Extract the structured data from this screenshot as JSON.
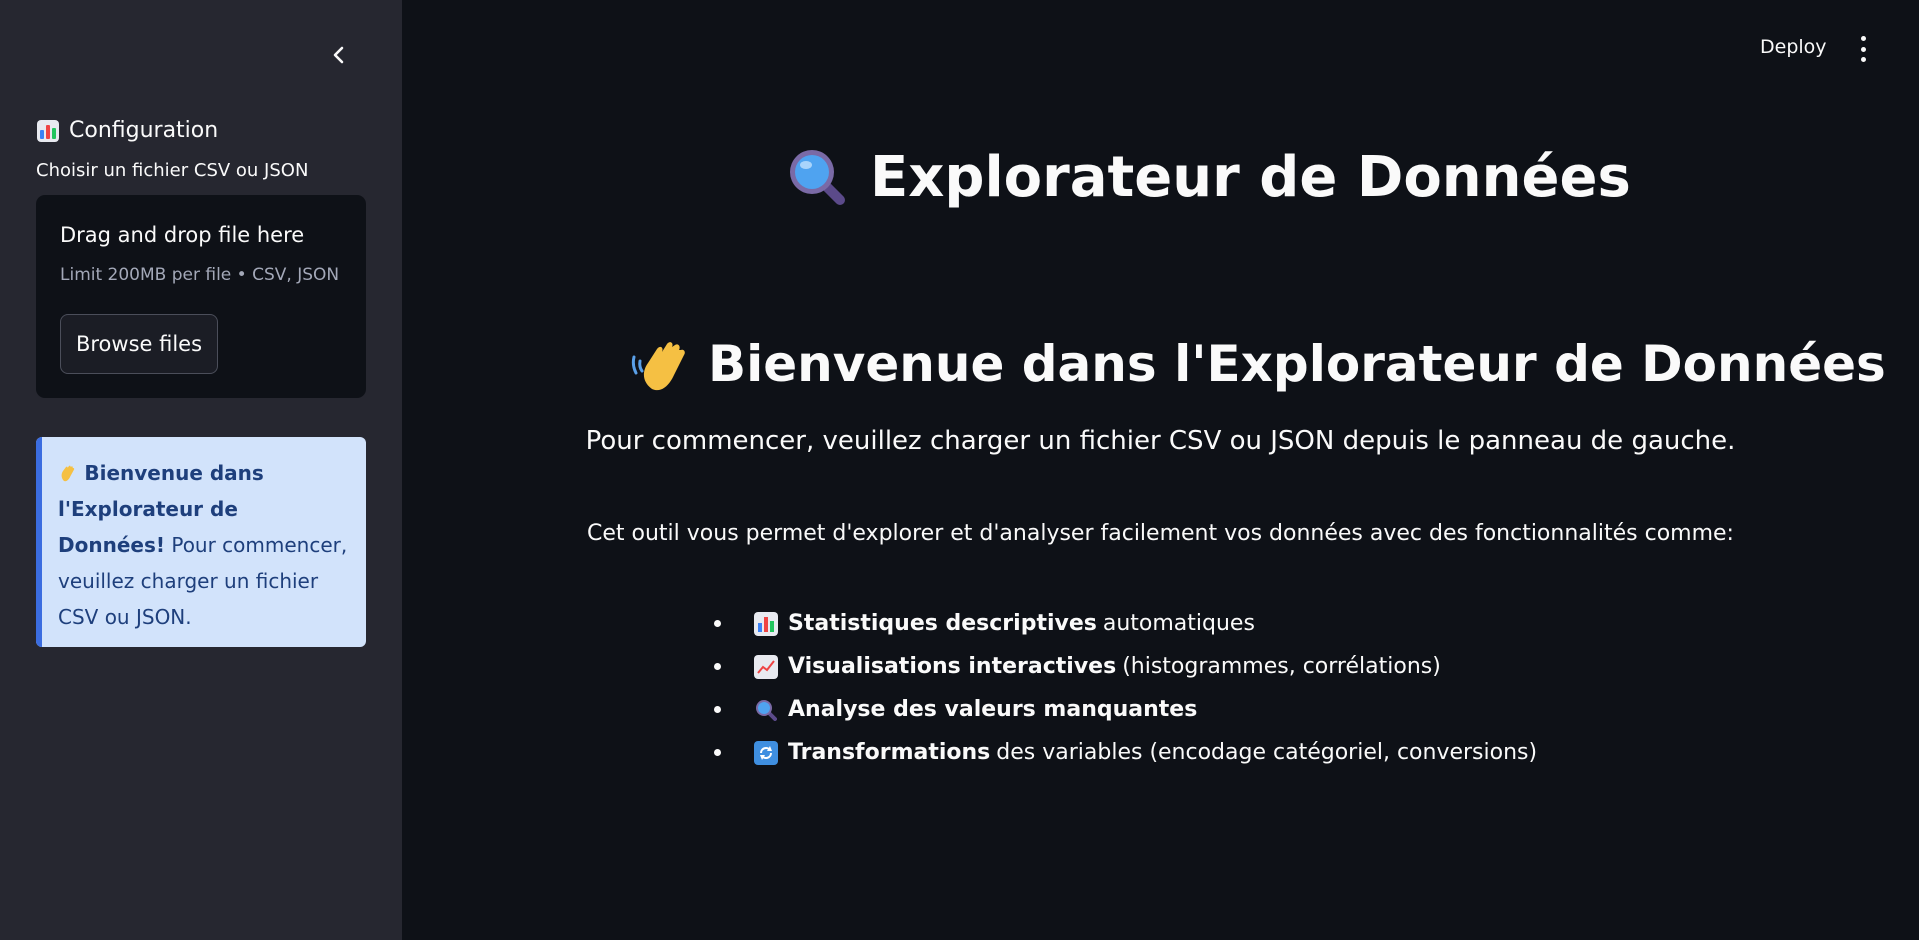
{
  "sidebar": {
    "title": "Configuration",
    "uploader_label": "Choisir un fichier CSV ou JSON",
    "dropzone_text": "Drag and drop file here",
    "limit_text": "Limit 200MB per file • CSV, JSON",
    "browse_label": "Browse files",
    "info": {
      "bold_text": "Bienvenue dans l'Explorateur de Données!",
      "body_text": "Pour commencer, veuillez charger un fichier CSV ou JSON."
    }
  },
  "header": {
    "deploy_label": "Deploy"
  },
  "main": {
    "title": "Explorateur de Données",
    "welcome": "Bienvenue dans l'Explorateur de Données",
    "intro": "Pour commencer, veuillez charger un fichier CSV ou JSON depuis le panneau de gauche.",
    "description": "Cet outil vous permet d'explorer et d'analyser facilement vos données avec des fonctionnalités comme:",
    "features": [
      {
        "icon": "bar-chart-icon",
        "bold": "Statistiques descriptives",
        "rest": "automatiques"
      },
      {
        "icon": "line-chart-icon",
        "bold": "Visualisations interactives",
        "rest": "(histogrammes, corrélations)"
      },
      {
        "icon": "magnifier-icon",
        "bold": "Analyse des valeurs manquantes",
        "rest": ""
      },
      {
        "icon": "refresh-icon",
        "bold": "Transformations",
        "rest": "des variables (encodage catégoriel, conversions)"
      }
    ]
  },
  "colors": {
    "app_bg": "#0e1117",
    "sidebar_bg": "#262730",
    "info_bg": "#d2e3fb",
    "info_text": "#1e3f7c",
    "info_accent": "#3b6de0"
  }
}
